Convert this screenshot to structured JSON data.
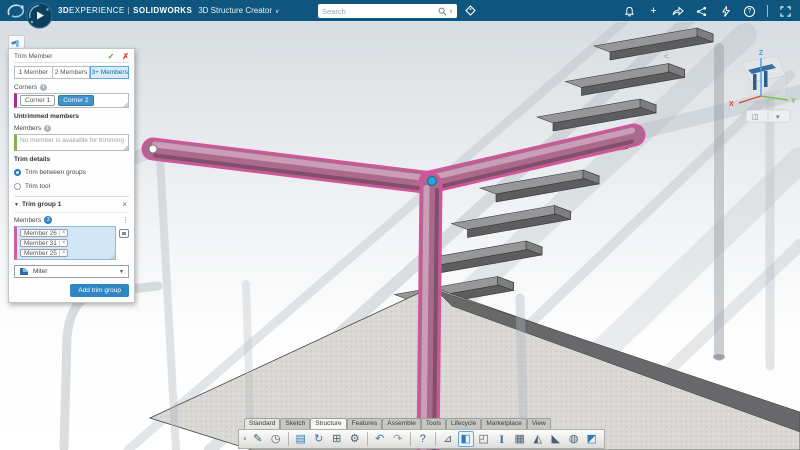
{
  "topbar": {
    "brand_prefix": "3D",
    "brand_suffix": "EXPERIENCE",
    "brand_divider": "|",
    "brand_product": "SOLIDWORKS",
    "app_name": "3D Structure Creator",
    "app_caret": "∨",
    "search_placeholder": "Search",
    "search_caret": "∨",
    "plus_glyph": "+",
    "help_glyph": "?",
    "right_icon_names": [
      "notification-bell-icon",
      "add-icon",
      "share-icon",
      "collaborate-icon",
      "flash-icon",
      "help-icon",
      "expand-icon"
    ]
  },
  "panel": {
    "title": "Trim Member",
    "ok_glyph": "✓",
    "cancel_glyph": "✗",
    "tabs": [
      "1 Member",
      "2 Members",
      "3+ Members"
    ],
    "active_tab": "3+ Members",
    "corners_label": "Corners",
    "info_glyph": "i",
    "corner_chips": [
      "Corner 1",
      "Corner 2"
    ],
    "selected_corner": "Corner 2",
    "untrimmed_label": "Untrimmed members",
    "members_label": "Members",
    "members_placeholder": "No member is available for trimming",
    "trim_details_label": "Trim details",
    "radio_between": "Trim between groups",
    "radio_tool": "Trim tool",
    "selected_radio": "Trim between groups",
    "chip_close": "×",
    "group": {
      "caret": "▼",
      "title": "Trim group 1",
      "close_glyph": "×",
      "members_label": "Members",
      "count": "3",
      "menu_glyph": "⋮",
      "chips": [
        "Member 26",
        "Member 31",
        "Member 25"
      ],
      "corner_type": "Miter",
      "dd_caret": "▼"
    },
    "add_button": "Add trim group"
  },
  "viewport": {
    "triad": {
      "x": "X",
      "y": "Y",
      "z": "Z"
    },
    "collapse_glyph": "<",
    "mini_toolbar_glyphs": {
      "view": "◫",
      "caret": "▾"
    },
    "selection": {
      "selected_members": [
        "Member 26",
        "Member 31",
        "Member 25"
      ],
      "member_color": "#aa6a8b",
      "selection_outline_color": "#d8509f",
      "vertex_color": "#2aa3dd"
    }
  },
  "toolbar": {
    "tabs": [
      "Standard",
      "Sketch",
      "Structure",
      "Features",
      "Assemble",
      "Tools",
      "Lifecycle",
      "Marketplace",
      "View"
    ],
    "active_tab": "Structure",
    "row_caret": "∨",
    "icons": [
      {
        "name": "new-design-icon",
        "glyph": "✎"
      },
      {
        "name": "history-icon",
        "glyph": "◷"
      },
      {
        "name": "save-icon",
        "glyph": "▤"
      },
      {
        "name": "sync-icon",
        "glyph": "↻"
      },
      {
        "name": "export-icon",
        "glyph": "⊞"
      },
      {
        "name": "settings-gear-icon",
        "glyph": "⚙"
      },
      {
        "name": "undo-icon",
        "glyph": "↶"
      },
      {
        "name": "redo-icon",
        "glyph": "↷"
      },
      {
        "name": "help-icon",
        "glyph": "?"
      },
      {
        "name": "sketch-icon",
        "glyph": "⊿"
      },
      {
        "name": "extrude-member-icon",
        "glyph": "◧"
      },
      {
        "name": "convert-solid-icon",
        "glyph": "◰"
      },
      {
        "name": "structure-beam-icon",
        "glyph": "I"
      },
      {
        "name": "panel-icon",
        "glyph": "▦"
      },
      {
        "name": "machining-icon",
        "glyph": "◭"
      },
      {
        "name": "chamfer-icon",
        "glyph": "◣"
      },
      {
        "name": "primitive-icon",
        "glyph": "◍"
      },
      {
        "name": "trim-member-icon",
        "glyph": "◩"
      }
    ]
  },
  "colors": {
    "topbar_bg": "#0f567e",
    "accent_blue": "#2e86c4",
    "tab_active_bg": "#d9ecf8",
    "member_chip_field_bg": "#d2e7f6",
    "corners_bar": "#aa2c8e",
    "members_bar": "#7ab648",
    "group_bar": "#d060a4",
    "triad_x": "#e04438",
    "triad_y": "#7ac143",
    "triad_z": "#3da0e8"
  }
}
